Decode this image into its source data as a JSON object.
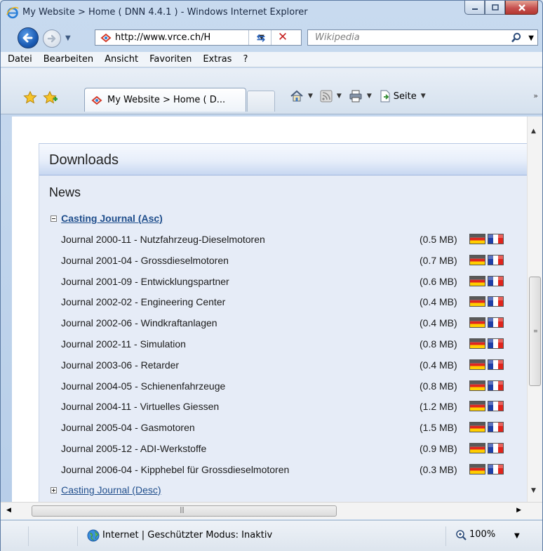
{
  "window": {
    "title": "My Website > Home ( DNN 4.4.1 ) - Windows Internet Explorer"
  },
  "address": {
    "url": "http://www.vrce.ch/H",
    "search_placeholder": "Wikipedia"
  },
  "menu": [
    "Datei",
    "Bearbeiten",
    "Ansicht",
    "Favoriten",
    "Extras",
    "?"
  ],
  "tab": {
    "label": "My Website > Home ( D...",
    "page_label": "Seite"
  },
  "page": {
    "module_title": "Downloads",
    "section_title": "News",
    "groups": [
      {
        "label": "Casting Journal (Asc)",
        "expanded": true,
        "items": [
          {
            "title": "Journal 2000-11 - Nutzfahrzeug-Dieselmotoren",
            "size": "(0.5 MB)"
          },
          {
            "title": "Journal 2001-04 - Grossdieselmotoren",
            "size": "(0.7 MB)"
          },
          {
            "title": "Journal 2001-09 - Entwicklungspartner",
            "size": "(0.6 MB)"
          },
          {
            "title": "Journal 2002-02 - Engineering Center",
            "size": "(0.4 MB)"
          },
          {
            "title": "Journal 2002-06 - Windkraftanlagen",
            "size": "(0.4 MB)"
          },
          {
            "title": "Journal 2002-11 - Simulation",
            "size": "(0.8 MB)"
          },
          {
            "title": "Journal 2003-06 - Retarder",
            "size": "(0.4 MB)"
          },
          {
            "title": "Journal 2004-05 - Schienenfahrzeuge",
            "size": "(0.8 MB)"
          },
          {
            "title": "Journal 2004-11 - Virtuelles Giessen",
            "size": "(1.2 MB)"
          },
          {
            "title": "Journal 2005-04 - Gasmotoren",
            "size": "(1.5 MB)"
          },
          {
            "title": "Journal 2005-12 - ADI-Werkstoffe",
            "size": "(0.9 MB)"
          },
          {
            "title": "Journal 2006-04 - Kipphebel für Grossdieselmotoren",
            "size": "(0.3 MB)"
          }
        ]
      },
      {
        "label": "Casting Journal (Desc)",
        "expanded": false,
        "items": []
      }
    ]
  },
  "status": {
    "text": "Internet | Geschützter Modus: Inaktiv",
    "zoom": "100%"
  },
  "colors": {
    "link": "#1f4e8c",
    "module_bg": "#e6ecf7",
    "flag_de": [
      "#1a1a1a",
      "#e0261f",
      "#ffce00"
    ],
    "flag_fr": [
      "#1f3fa8",
      "#ffffff",
      "#e1241c"
    ]
  },
  "icons": {
    "browser": "ie-logo-icon",
    "back": "back-arrow-icon",
    "forward": "forward-arrow-icon",
    "refresh": "refresh-icon",
    "stop": "stop-icon",
    "search": "search-icon",
    "favorites": "favorites-star-icon",
    "add_favorite": "add-favorite-icon",
    "home": "home-icon",
    "feeds": "rss-feed-icon",
    "print": "print-icon",
    "page": "page-icon",
    "zone": "globe-icon",
    "zoom": "zoom-icon",
    "language_de": "flag-germany-icon",
    "language_fr": "flag-france-icon"
  }
}
